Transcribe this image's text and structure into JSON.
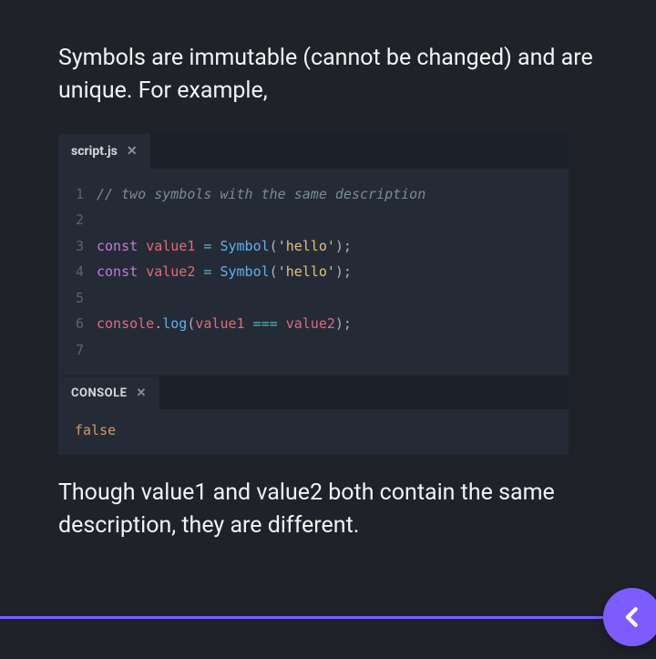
{
  "intro_text": "Symbols are immutable (cannot be changed) and are unique. For example,",
  "outro_text": "Though value1 and value2 both contain the same description, they are different.",
  "editor": {
    "tab_label": "script.js",
    "line_numbers": [
      "1",
      "2",
      "3",
      "4",
      "5",
      "6",
      "7"
    ],
    "code": [
      {
        "type": "comment",
        "text": "// two symbols with the same description"
      },
      {
        "type": "blank",
        "text": ""
      },
      {
        "type": "decl",
        "keyword": "const",
        "ident": "value1",
        "op": "=",
        "func": "Symbol",
        "str": "'hello'",
        "tail": ");"
      },
      {
        "type": "decl",
        "keyword": "const",
        "ident": "value2",
        "op": "=",
        "func": "Symbol",
        "str": "'hello'",
        "tail": ");"
      },
      {
        "type": "blank",
        "text": ""
      },
      {
        "type": "call",
        "obj": "console",
        "method": "log",
        "arg1": "value1",
        "op": "===",
        "arg2": "value2",
        "tail": ");"
      },
      {
        "type": "blank",
        "text": ""
      }
    ]
  },
  "console": {
    "tab_label": "CONSOLE",
    "output": "false"
  }
}
